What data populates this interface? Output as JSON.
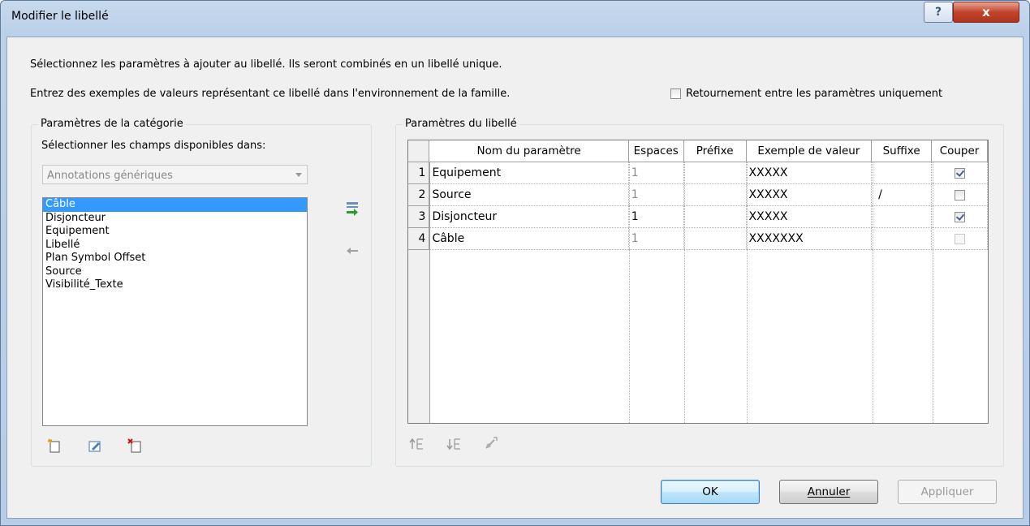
{
  "window": {
    "title": "Modifier le libellé",
    "help_label": "?",
    "close_label": "x"
  },
  "intro": {
    "line1": "Sélectionnez les paramètres à ajouter au libellé. Ils seront combinés en un libellé unique.",
    "line2": "Entrez des exemples de valeurs représentant ce libellé dans l'environnement de la famille.",
    "wrap_option_label": "Retournement entre les paramètres uniquement",
    "wrap_option_checked": false
  },
  "category_panel": {
    "title": "Paramètres de la catégorie",
    "select_label": "Sélectionner les champs disponibles dans:",
    "combo_value": "Annotations génériques",
    "items": [
      {
        "label": "Câble",
        "selected": true
      },
      {
        "label": "Disjoncteur",
        "selected": false
      },
      {
        "label": "Equipement",
        "selected": false
      },
      {
        "label": "Libellé",
        "selected": false
      },
      {
        "label": "Plan Symbol Offset",
        "selected": false
      },
      {
        "label": "Source",
        "selected": false
      },
      {
        "label": "Visibilité_Texte",
        "selected": false
      }
    ],
    "icons": [
      "new-parameter-icon",
      "edit-parameter-icon",
      "delete-parameter-icon"
    ]
  },
  "transfer_icons": [
    "add-parameter-arrow-icon",
    "remove-parameter-arrow-icon"
  ],
  "label_panel": {
    "title": "Paramètres du libellé",
    "columns": [
      "Nom du paramètre",
      "Espaces",
      "Préfixe",
      "Exemple de valeur",
      "Suffixe",
      "Couper"
    ],
    "rows": [
      {
        "num": "1",
        "name": "Equipement",
        "spaces": "1",
        "prefix": "",
        "sample": "XXXXX",
        "suffix": "",
        "wrap": true,
        "wrap_enabled": true,
        "spaces_gray": true
      },
      {
        "num": "2",
        "name": "Source",
        "spaces": "1",
        "prefix": "",
        "sample": "XXXXX",
        "suffix": "/",
        "wrap": false,
        "wrap_enabled": true,
        "spaces_gray": true
      },
      {
        "num": "3",
        "name": "Disjoncteur",
        "spaces": "1",
        "prefix": "",
        "sample": "XXXXX",
        "suffix": "",
        "wrap": true,
        "wrap_enabled": true,
        "spaces_gray": false
      },
      {
        "num": "4",
        "name": "Câble",
        "spaces": "1",
        "prefix": "",
        "sample": "XXXXXXX",
        "suffix": "",
        "wrap": false,
        "wrap_enabled": false,
        "spaces_gray": true
      }
    ],
    "bottom_icons": [
      "move-up-icon",
      "move-down-icon",
      "calculated-value-icon"
    ]
  },
  "buttons": {
    "ok": "OK",
    "cancel": "Annuler",
    "apply": "Appliquer"
  }
}
